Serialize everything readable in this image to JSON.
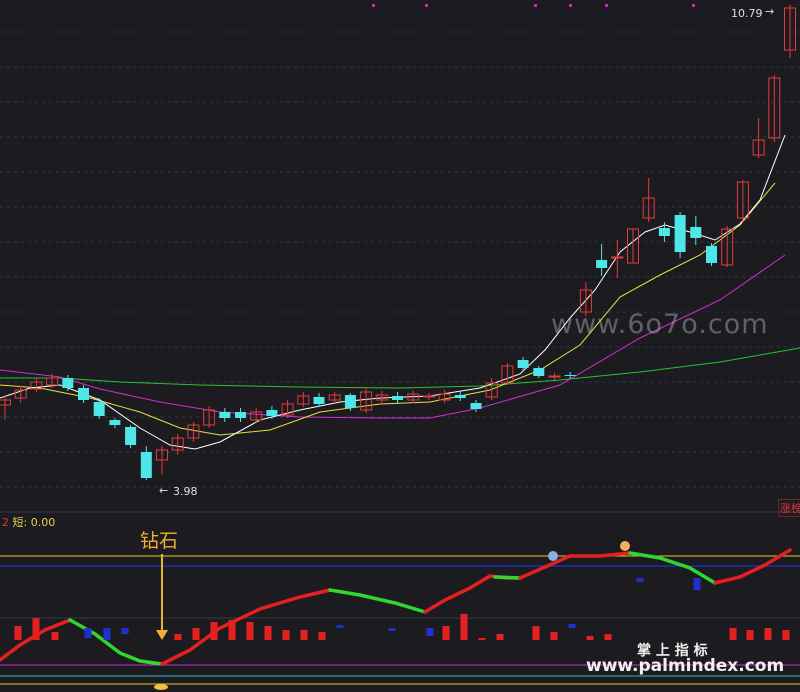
{
  "chart_data": [
    {
      "type": "candlestick",
      "candles": [
        [
          0,
          405,
          400,
          420,
          396
        ],
        [
          1,
          398,
          390,
          403,
          386
        ],
        [
          2,
          389,
          382,
          392,
          378
        ],
        [
          3,
          385,
          378,
          388,
          374
        ],
        [
          4,
          378,
          388,
          375,
          391
        ],
        [
          5,
          388,
          400,
          385,
          403
        ],
        [
          6,
          402,
          416,
          398,
          419
        ],
        [
          7,
          420,
          425,
          418,
          428
        ],
        [
          8,
          427,
          445,
          425,
          448
        ],
        [
          9,
          452,
          478,
          446,
          480
        ],
        [
          10,
          460,
          450,
          475,
          446
        ],
        [
          11,
          450,
          438,
          455,
          434
        ],
        [
          12,
          438,
          425,
          442,
          422
        ],
        [
          13,
          425,
          410,
          428,
          406
        ],
        [
          14,
          412,
          418,
          408,
          422
        ],
        [
          15,
          412,
          418,
          408,
          422
        ],
        [
          16,
          420,
          412,
          423,
          408
        ],
        [
          17,
          410,
          416,
          406,
          419
        ],
        [
          18,
          415,
          404,
          418,
          400
        ],
        [
          19,
          404,
          396,
          407,
          392
        ],
        [
          20,
          397,
          404,
          393,
          407
        ],
        [
          21,
          400,
          395,
          403,
          392
        ],
        [
          22,
          395,
          408,
          393,
          411
        ],
        [
          23,
          410,
          392,
          413,
          388
        ],
        [
          24,
          400,
          395,
          405,
          391
        ],
        [
          25,
          396,
          400,
          392,
          403
        ],
        [
          26,
          400,
          394,
          403,
          391
        ],
        [
          27,
          397,
          396,
          400,
          393
        ],
        [
          28,
          400,
          394,
          403,
          390
        ],
        [
          29,
          395,
          398,
          392,
          401
        ],
        [
          30,
          403,
          409,
          400,
          412
        ],
        [
          31,
          397,
          383,
          400,
          378
        ],
        [
          32,
          383,
          366,
          385,
          363
        ],
        [
          33,
          360,
          368,
          357,
          371
        ],
        [
          34,
          368,
          376,
          366,
          378
        ],
        [
          35,
          377,
          376,
          380,
          373
        ],
        [
          36,
          375,
          376,
          379,
          372
        ],
        [
          37,
          312,
          290,
          316,
          282
        ],
        [
          38,
          260,
          268,
          244,
          276
        ],
        [
          39,
          258,
          257,
          240,
          278
        ],
        [
          40,
          263,
          229,
          263,
          229
        ],
        [
          41,
          218,
          198,
          222,
          178
        ],
        [
          42,
          228,
          236,
          222,
          242
        ],
        [
          43,
          215,
          252,
          212,
          258
        ],
        [
          44,
          227,
          238,
          216,
          245
        ],
        [
          45,
          246,
          263,
          243,
          266
        ],
        [
          46,
          265,
          229,
          267,
          226
        ],
        [
          47,
          218,
          182,
          222,
          180
        ],
        [
          48,
          155,
          140,
          158,
          118
        ],
        [
          49,
          138,
          78,
          142,
          75
        ],
        [
          50,
          50,
          8,
          58,
          5
        ]
      ],
      "price_labels": {
        "high": "10.79",
        "low": "3.98"
      },
      "watermark": "www.6o7o.com",
      "tag": "涨榜"
    },
    {
      "type": "line",
      "indicator_label": "短: 0.00",
      "series_prefix": "2",
      "annotation": "钻石",
      "footer_brand": "掌 上 指 标",
      "footer_url": "www.palmindex.com"
    }
  ]
}
